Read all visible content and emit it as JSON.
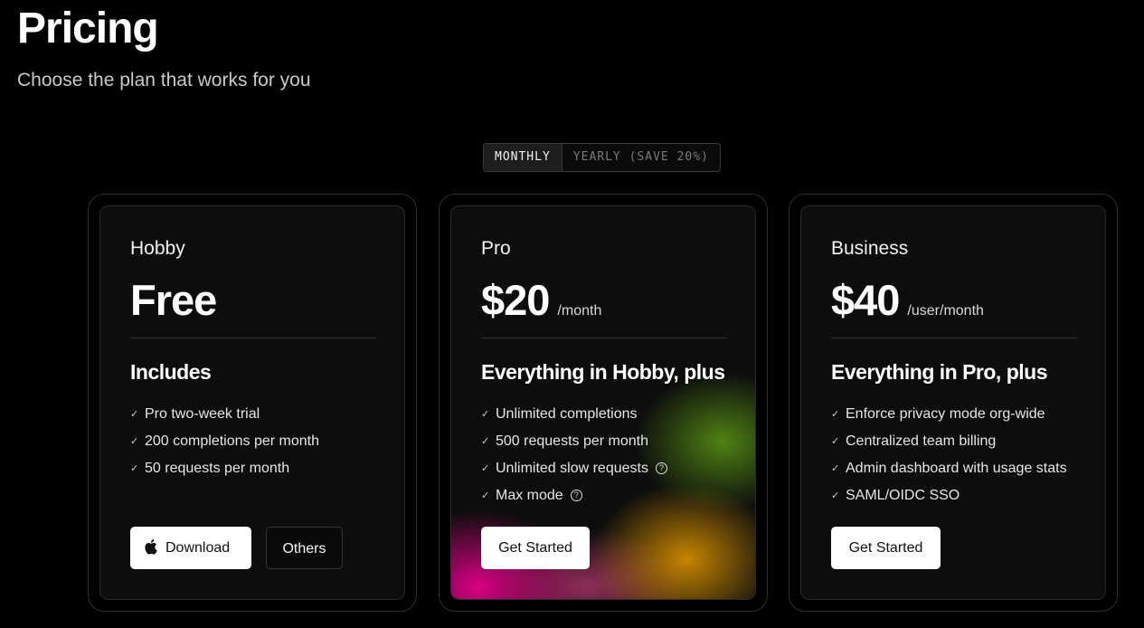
{
  "header": {
    "title": "Pricing",
    "subtitle": "Choose the plan that works for you"
  },
  "billing_toggle": {
    "options": [
      "MONTHLY",
      "YEARLY (SAVE 20%)"
    ],
    "selected": "MONTHLY"
  },
  "plans": [
    {
      "name": "Hobby",
      "price": "Free",
      "period": "",
      "heading": "Includes",
      "features": [
        {
          "text": "Pro two-week trial"
        },
        {
          "text": "200 completions per month"
        },
        {
          "text": "50 requests per month"
        }
      ],
      "buttons": [
        {
          "label": "Download",
          "icon": "apple-icon"
        },
        {
          "label": "Others"
        }
      ]
    },
    {
      "name": "Pro",
      "price": "$20",
      "period": "/month",
      "heading": "Everything in Hobby, plus",
      "features": [
        {
          "text": "Unlimited completions"
        },
        {
          "text": "500 requests per month"
        },
        {
          "text": "Unlimited slow requests",
          "info": true
        },
        {
          "text": "Max mode",
          "info": true
        }
      ],
      "buttons": [
        {
          "label": "Get Started"
        }
      ]
    },
    {
      "name": "Business",
      "price": "$40",
      "period": "/user/month",
      "heading": "Everything in Pro, plus",
      "features": [
        {
          "text": "Enforce privacy mode org-wide"
        },
        {
          "text": "Centralized team billing"
        },
        {
          "text": "Admin dashboard with usage stats"
        },
        {
          "text": "SAML/OIDC SSO"
        }
      ],
      "buttons": [
        {
          "label": "Get Started"
        }
      ]
    }
  ],
  "glyphs": {
    "check": "✓",
    "info": "?"
  }
}
